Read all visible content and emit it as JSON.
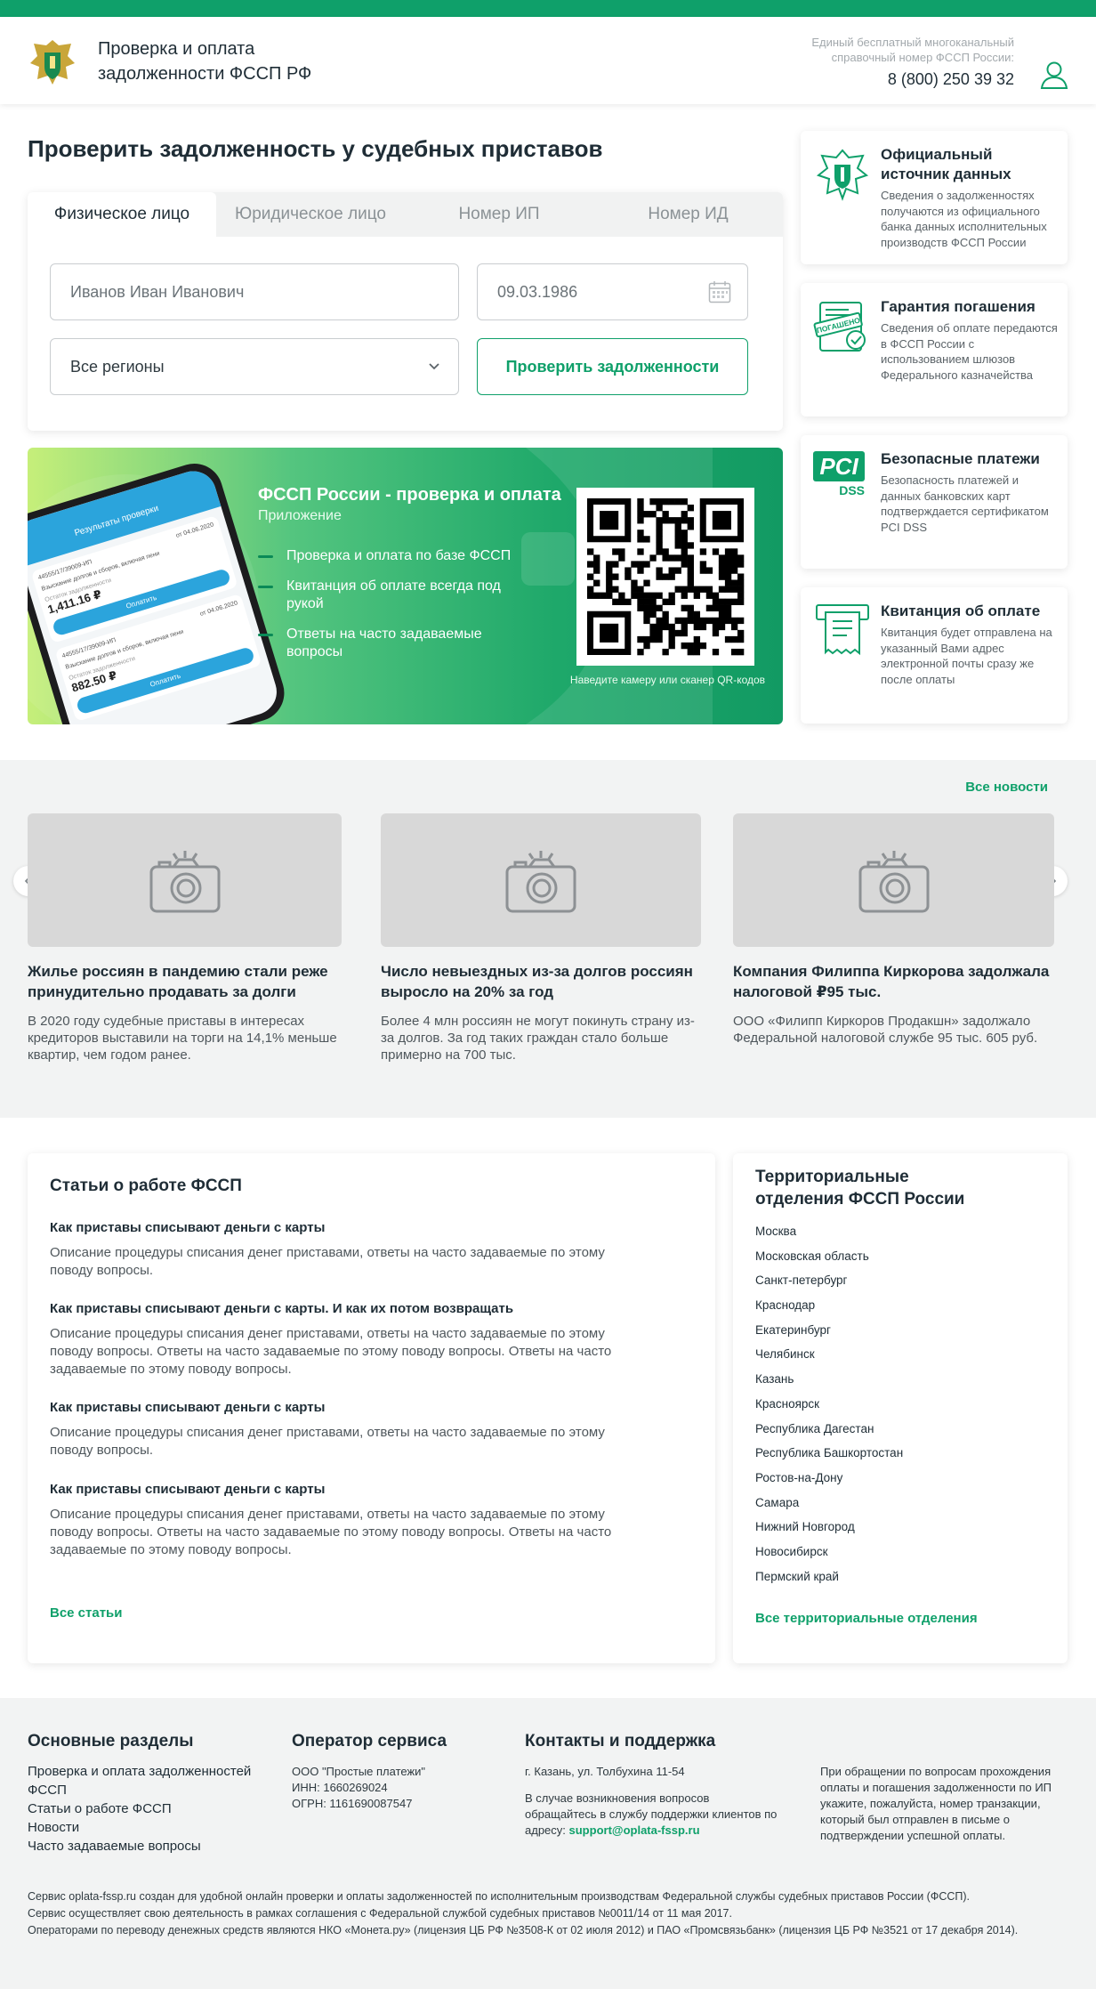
{
  "header": {
    "brand_line1": "Проверка и оплата",
    "brand_line2": "задолженности ФССП РФ",
    "hotline_caption_1": "Единый бесплатный многоканальный",
    "hotline_caption_2": "справочный номер ФССП России:",
    "phone": "8 (800) 250 39 32"
  },
  "main": {
    "title": "Проверить задолженность у судебных приставов"
  },
  "search": {
    "tabs": [
      {
        "label": "Физическое лицо"
      },
      {
        "label": "Юридическое лицо"
      },
      {
        "label": "Номер ИП"
      },
      {
        "label": "Номер ИД"
      }
    ],
    "name_value": "Иванов Иван Иванович",
    "date_value": "09.03.1986",
    "region_value": "Все регионы",
    "submit_label": "Проверить задолженности"
  },
  "promo": {
    "title": "ФССП России - проверка и оплата",
    "subtitle": "Приложение",
    "items": [
      "Проверка и оплата по базе ФССП",
      "Квитанция об оплате всегда под рукой",
      "Ответы на часто задаваемые вопросы"
    ],
    "qr_caption": "Наведите камеру или сканер QR-кодов",
    "phone_screen": {
      "header": "Результаты проверки",
      "id1": "44555/17/39009-ИП",
      "date1": "от 04.06.2020",
      "desc1": "Взыскание долгов и сборов, включая пени",
      "cap1": "Остаток задолженности",
      "amount1": "1,411.16 ₽",
      "pay": "Оплатить",
      "id2": "44555/17/39009-ИП",
      "date2": "от 04.06.2020",
      "desc2": "Взыскание долгов и сборов, включая пени",
      "cap2": "Остаток задолженности",
      "amount2": "882.50 ₽"
    }
  },
  "features": [
    {
      "title": "Официальный источник данных",
      "desc": "Сведения о задолженностях получаются из официального банка данных исполнительных производств ФССП России"
    },
    {
      "title": "Гарантия погашения",
      "desc": "Сведения об оплате передаются в ФССП России с использованием шлюзов Федерального казначейства",
      "stamp": "ПОГАШЕНО"
    },
    {
      "title": "Безопасные платежи",
      "desc": "Безопасность платежей и данных банковских карт подтверждается сертификатом PCI DSS",
      "logo_big": "PCI",
      "logo_small": "DSS"
    },
    {
      "title": "Квитанция об оплате",
      "desc": "Квитанция будет отправлена на указанный Вами адрес электронной почты сразу же после оплаты"
    }
  ],
  "news": {
    "all_label": "Все новости",
    "items": [
      {
        "title": "Жилье россиян в пандемию стали реже принудительно продавать за долги",
        "desc": "В 2020 году судебные приставы в интересах кредиторов выставили на торги на 14,1% меньше квартир, чем годом ранее."
      },
      {
        "title": "Число невыездных из-за долгов россиян выросло на 20% за год",
        "desc": "Более 4 млн россиян не могут покинуть страну из-за долгов. За год таких граждан стало больше примерно на 700 тыс."
      },
      {
        "title": "Компания Филиппа Киркорова задолжала налоговой ₽95 тыс.",
        "desc": "ООО «Филипп Киркоров Продакшн» задолжало Федеральной налоговой службе 95 тыс. 605 руб."
      }
    ]
  },
  "articles": {
    "title": "Статьи о работе ФССП",
    "items": [
      {
        "title": "Как приставы списывают деньги с карты",
        "desc": "Описание процедуры списания денег приставами, ответы на часто задаваемые по этому поводу вопросы."
      },
      {
        "title": "Как приставы списывают деньги с карты. И как их потом возвращать",
        "desc": "Описание процедуры списания денег приставами, ответы на часто задаваемые по этому поводу вопросы. Ответы на часто задаваемые по этому поводу вопросы. Ответы на часто задаваемые по этому поводу вопросы."
      },
      {
        "title": "Как приставы списывают деньги с карты",
        "desc": "Описание процедуры списания денег приставами, ответы на часто задаваемые по этому поводу вопросы."
      },
      {
        "title": "Как приставы списывают деньги с карты",
        "desc": "Описание процедуры списания денег приставами, ответы на часто задаваемые по этому поводу вопросы. Ответы на часто задаваемые по этому поводу вопросы. Ответы на часто задаваемые по этому поводу вопросы."
      }
    ],
    "all_label": "Все статьи"
  },
  "territorial": {
    "title_line1": "Территориальные",
    "title_line2": "отделения ФССП России",
    "items": [
      "Москва",
      "Московская область",
      "Санкт-петербург",
      "Краснодар",
      "Екатеринбург",
      "Челябинск",
      "Казань",
      "Красноярск",
      "Республика Дагестан",
      "Республика Башкортостан",
      "Ростов-на-Дону",
      "Самара",
      "Нижний Новгород",
      "Новосибирск",
      "Пермский край"
    ],
    "all_label": "Все территориальные отделения"
  },
  "footer": {
    "sections_title": "Основные разделы",
    "sections": [
      "Проверка и оплата задолженностей ФССП",
      "Статьи о работе ФССП",
      "Новости",
      "Часто задаваемые вопросы"
    ],
    "operator_title": "Оператор сервиса",
    "operator_lines": [
      "ООО \"Простые платежи\"",
      "ИНН: 1660269024",
      "ОГРН: 1161690087547"
    ],
    "contacts_title": "Контакты и поддержка",
    "address": "г. Казань, ул. Толбухина 11-54",
    "support_text": "В случае возникновения вопросов обращайтесь в службу поддержки клиентов по адресу:",
    "support_email": "support@oplata-fssp.ru",
    "note": "При обращении по вопросам прохождения оплаты и погашения задолженности по ИП укажите, пожалуйста, номер транзакции, который был отправлен в письме о подтверждении успешной оплаты.",
    "legal": [
      "Сервис oplata-fssp.ru создан для удобной онлайн проверки и оплаты задолженностей по исполнительным производствам Федеральной службы судебных приставов России (ФССП).",
      "Сервис осуществляет свою деятельность в рамках соглашения с Федеральной службой судебных приставов №0011/14 от 11 мая 2017.",
      "Операторами по переводу денежных средств являются НКО «Монета.ру» (лицензия ЦБ РФ №3508-К от 02 июля 2012) и ПАО «Промсвязьбанк» (лицензия ЦБ РФ №3521 от 17 декабря 2014)."
    ]
  }
}
